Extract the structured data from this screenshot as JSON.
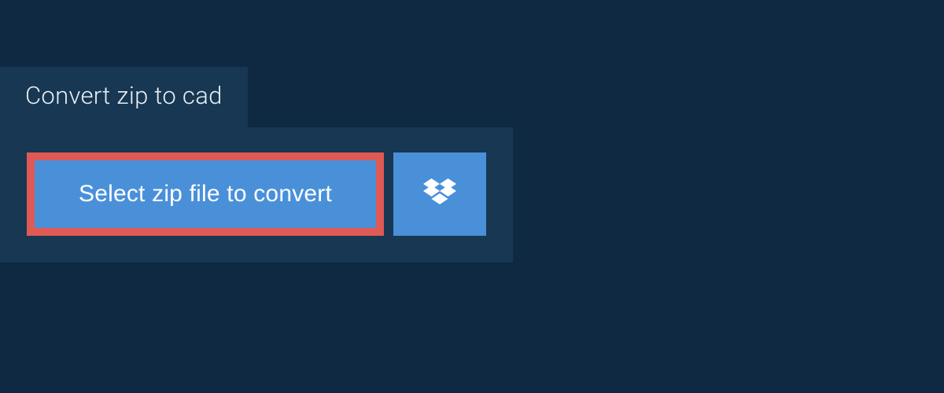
{
  "tab": {
    "title": "Convert zip to cad"
  },
  "upload": {
    "select_label": "Select zip file to convert"
  },
  "colors": {
    "bg": "#0f2942",
    "panel": "#173753",
    "button": "#4a90d9",
    "highlight_border": "#e05a55"
  }
}
